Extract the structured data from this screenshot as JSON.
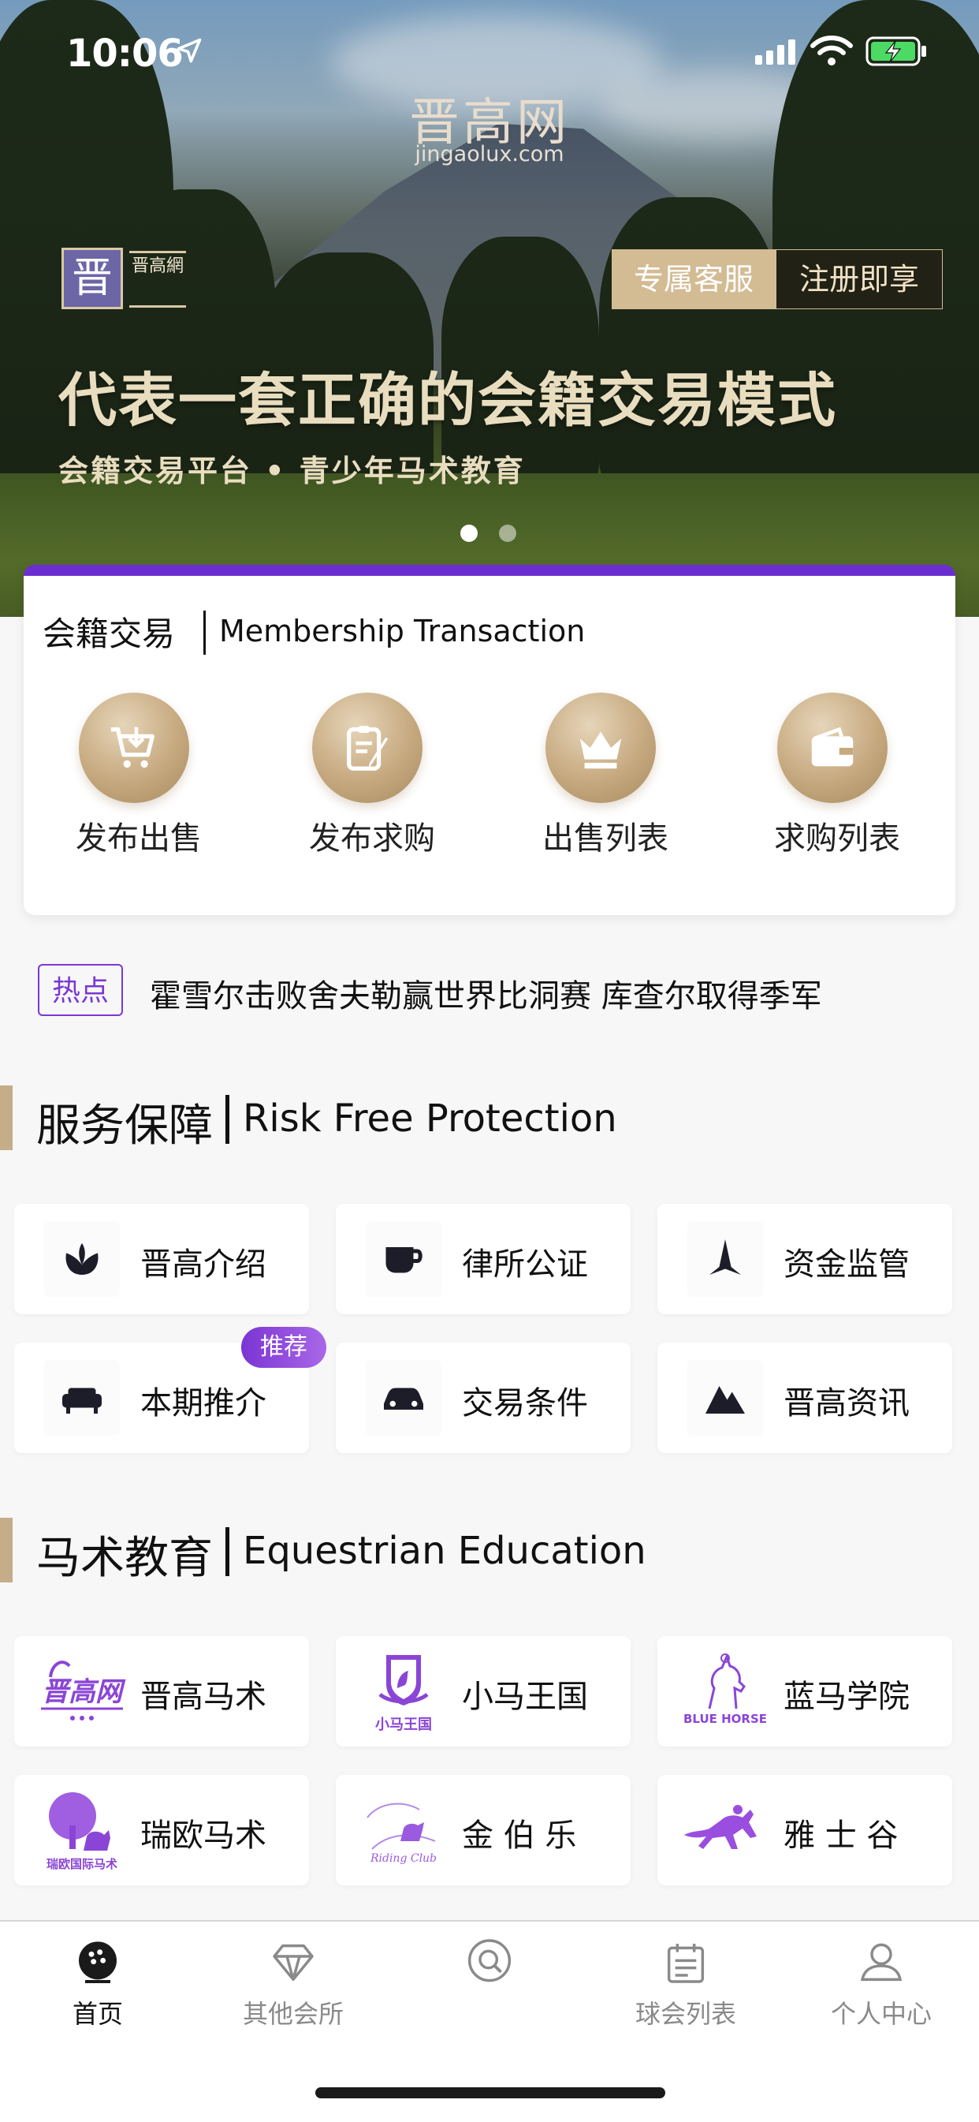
{
  "status": {
    "time": "10:06"
  },
  "banner": {
    "brand_name": "晋高网",
    "brand_domain": "jingaolux.com",
    "logo_char": "晋",
    "logo_text": "晋高網",
    "logo_sub": "jingaolux.com",
    "service_button": "专属客服",
    "register_button": "注册即享",
    "headline": "代表一套正确的会籍交易模式",
    "subline": "会籍交易平台 • 青少年马术教育",
    "pages": 2,
    "active_page": 1
  },
  "membership": {
    "title": "会籍交易",
    "subtitle": "Membership Transaction",
    "actions": [
      {
        "label": "发布出售",
        "icon": "cart-icon"
      },
      {
        "label": "发布求购",
        "icon": "clipboard-pen-icon"
      },
      {
        "label": "出售列表",
        "icon": "crown-icon"
      },
      {
        "label": "求购列表",
        "icon": "wallet-icon"
      }
    ]
  },
  "news": {
    "tag": "热点",
    "headline": "霍雪尔击败舍夫勒赢世界比洞赛 库查尔取得季军"
  },
  "service": {
    "title": "服务保障",
    "subtitle": "Risk Free Protection",
    "badge": "推荐",
    "items": [
      {
        "label": "晋高介绍",
        "icon": "lotus-icon"
      },
      {
        "label": "律所公证",
        "icon": "cup-icon"
      },
      {
        "label": "资金监管",
        "icon": "star-icon"
      },
      {
        "label": "本期推介",
        "icon": "sofa-icon"
      },
      {
        "label": "交易条件",
        "icon": "car-icon"
      },
      {
        "label": "晋高资讯",
        "icon": "mountain-icon"
      }
    ]
  },
  "equestrian": {
    "title": "马术教育",
    "subtitle": "Equestrian Education",
    "items": [
      {
        "label": "晋高马术",
        "logo": "jingao-logo",
        "logo_text": "晋高网"
      },
      {
        "label": "小马王国",
        "logo": "pony-kingdom-logo",
        "logo_text": "小马王国"
      },
      {
        "label": "蓝马学院",
        "logo": "blue-horse-logo",
        "logo_text": "BLUE HORSE"
      },
      {
        "label": "瑞欧马术",
        "logo": "ruiou-logo",
        "logo_text": "瑞欧国际马术"
      },
      {
        "label": "金 伯 乐",
        "logo": "jinbole-logo",
        "logo_text": "Riding Club"
      },
      {
        "label": "雅 士 谷",
        "logo": "yashigu-logo",
        "logo_text": ""
      }
    ]
  },
  "tabbar": {
    "tabs": [
      {
        "label": "首页",
        "icon": "golf-ball-icon",
        "active": true
      },
      {
        "label": "其他会所",
        "icon": "diamond-icon",
        "active": false
      },
      {
        "label": "",
        "icon": "search-icon",
        "active": false
      },
      {
        "label": "球会列表",
        "icon": "list-icon",
        "active": false
      },
      {
        "label": "个人中心",
        "icon": "user-icon",
        "active": false
      }
    ]
  },
  "colors": {
    "accent_purple": "#6b2fd1",
    "gold": "#c6a97f",
    "badge_gradient": [
      "#7b34d3",
      "#a968e8"
    ]
  }
}
